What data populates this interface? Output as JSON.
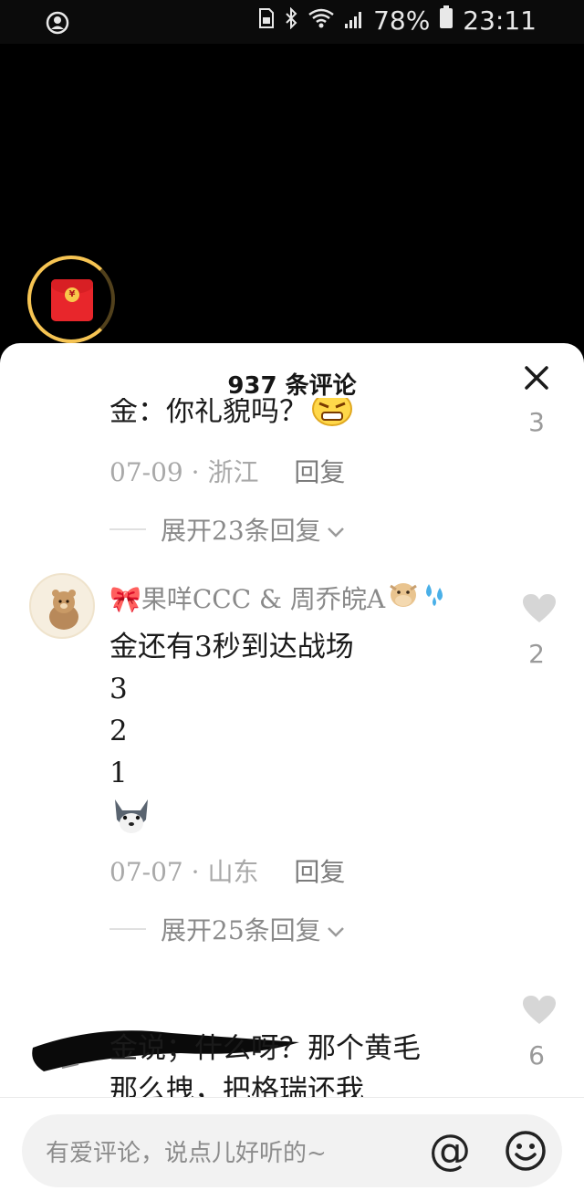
{
  "status_bar": {
    "battery_percent": "78%",
    "time": "23:11"
  },
  "sheet": {
    "title": "937 条评论",
    "close_icon": "close-icon"
  },
  "comments": [
    {
      "text": "金：你礼貌吗？",
      "emoji": "angry-face-emoji",
      "date": "07-09",
      "location": "浙江",
      "reply_label": "回复",
      "likes": "3",
      "expand_label": "展开23条回复"
    },
    {
      "username": "🎀果咩CCC & 周乔皖A",
      "username_emojis": [
        "cow-face-emoji",
        "sweat-droplets-emoji"
      ],
      "text_lines": [
        "金还有3秒到达战场",
        "3",
        "2",
        "1"
      ],
      "emoji": "husky-dog-emoji",
      "date": "07-07",
      "location": "山东",
      "reply_label": "回复",
      "likes": "2",
      "expand_label": "展开25条回复"
    },
    {
      "text_lines": [
        "金说；什么呀？那个黄毛",
        "那么拽，把格瑞还我"
      ],
      "likes": "6"
    }
  ],
  "input": {
    "placeholder": "有爱评论，说点儿好听的~",
    "at_symbol": "@"
  },
  "colors": {
    "sheet_bg": "#ffffff",
    "muted_text": "#a9a9a9",
    "redpacket": "#e8262b",
    "ring": "#f6c453"
  }
}
